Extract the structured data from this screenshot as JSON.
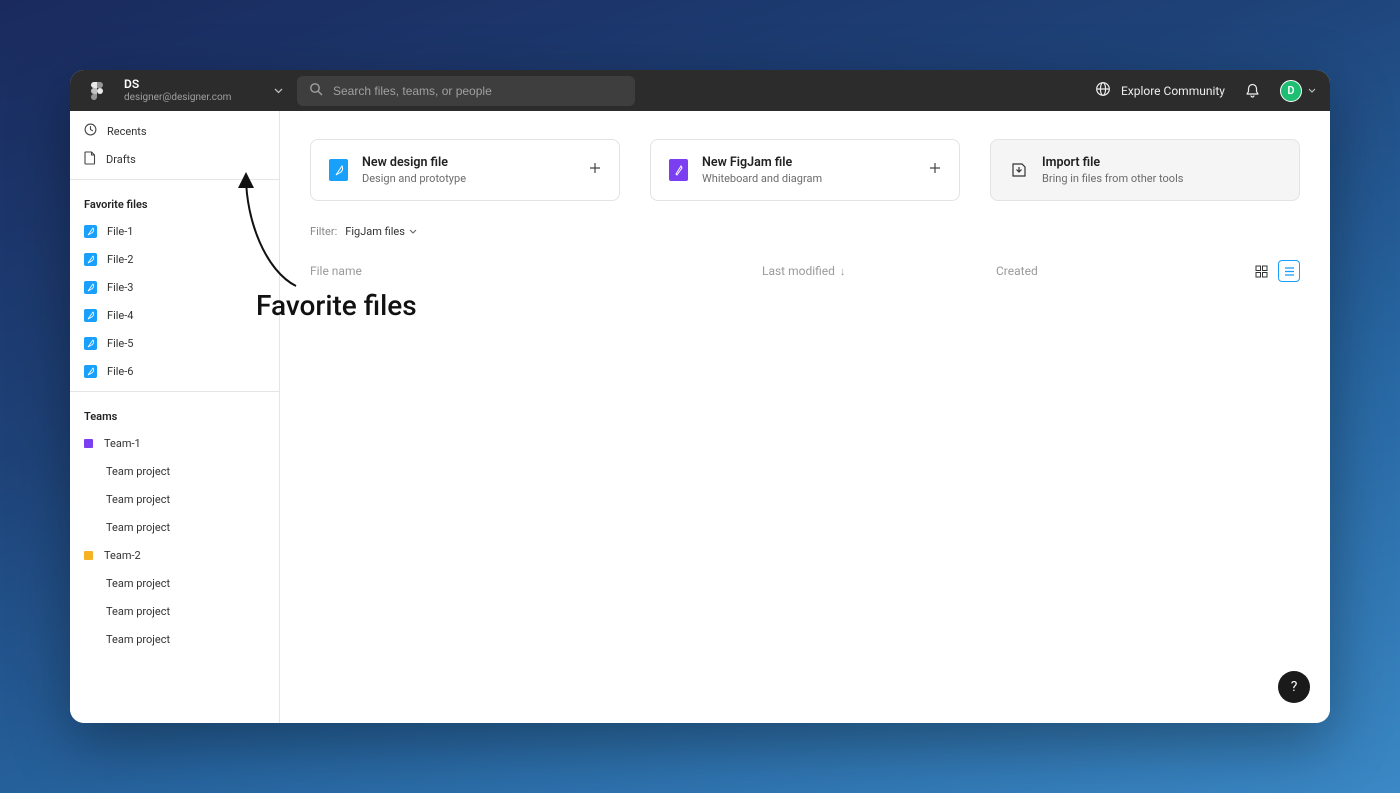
{
  "header": {
    "account_name": "DS",
    "account_email": "designer@designer.com",
    "search_placeholder": "Search files, teams, or people",
    "explore_label": "Explore Community",
    "avatar_letter": "D"
  },
  "sidebar": {
    "nav": [
      {
        "label": "Recents",
        "icon": "clock"
      },
      {
        "label": "Drafts",
        "icon": "page"
      }
    ],
    "favorites_heading": "Favorite files",
    "favorites": [
      {
        "label": "File-1"
      },
      {
        "label": "File-2"
      },
      {
        "label": "File-3"
      },
      {
        "label": "File-4"
      },
      {
        "label": "File-5"
      },
      {
        "label": "File-6"
      }
    ],
    "teams_heading": "Teams",
    "teams": [
      {
        "name": "Team-1",
        "color": "#7b3ff1",
        "projects": [
          "Team project",
          "Team project",
          "Team project"
        ]
      },
      {
        "name": "Team-2",
        "color": "#f5b324",
        "projects": [
          "Team project",
          "Team project",
          "Team project"
        ]
      }
    ]
  },
  "cards": {
    "design": {
      "title": "New design file",
      "subtitle": "Design and prototype"
    },
    "figjam": {
      "title": "New FigJam file",
      "subtitle": "Whiteboard and diagram"
    },
    "import": {
      "title": "Import file",
      "subtitle": "Bring in files from other tools"
    }
  },
  "filter": {
    "label": "Filter:",
    "value": "FigJam files"
  },
  "table": {
    "col_name": "File name",
    "col_modified": "Last modified",
    "col_created": "Created",
    "sort_dir": "↓"
  },
  "help_label": "?",
  "annotation": {
    "label": "Favorite files"
  },
  "colors": {
    "accent_blue": "#18a0fb",
    "figjam_purple": "#7b3ff1",
    "avatar_green": "#1fbf73"
  }
}
